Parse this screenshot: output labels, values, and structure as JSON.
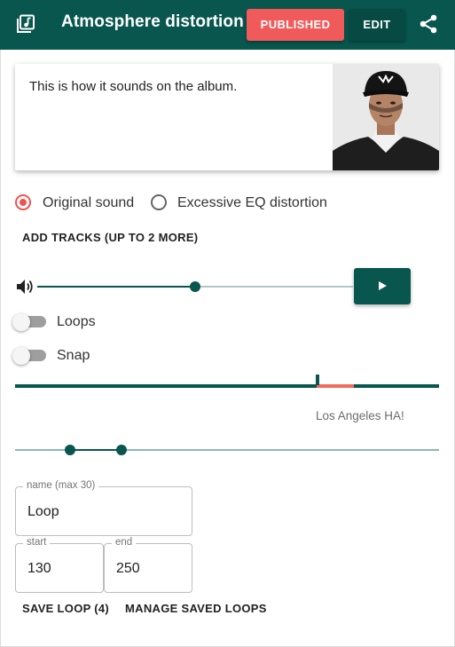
{
  "header": {
    "title": "Atmosphere distortion",
    "published_label": "PUBLISHED",
    "edit_label": "EDIT",
    "app_icon": "music-library-icon",
    "share_icon": "share-icon",
    "bg_color": "#08564e",
    "accent_color": "#f05a5a"
  },
  "card": {
    "text": "This is how it sounds on the album.",
    "image": "artist-photo"
  },
  "sound_options": {
    "selected": "Original sound",
    "options": [
      "Original sound",
      "Excessive EQ distortion"
    ]
  },
  "add_tracks_label": "ADD TRACKS (UP TO 2 MORE)",
  "player": {
    "volume_icon": "volume-icon",
    "volume_level": 0.45,
    "play_icon": "play-icon"
  },
  "toggles": {
    "loops_label": "Loops",
    "loops_on": false,
    "snap_label": "Snap",
    "snap_on": false
  },
  "waveform": {
    "annotation": "Los Angeles HA!",
    "region_color": "#f06b5e"
  },
  "loop_editor": {
    "name_label": "name (max 30)",
    "name_value": "Loop",
    "start_label": "start",
    "start_value": "130",
    "end_label": "end",
    "end_value": "250",
    "save_label": "SAVE LOOP (4)",
    "manage_label": "MANAGE SAVED LOOPS"
  }
}
